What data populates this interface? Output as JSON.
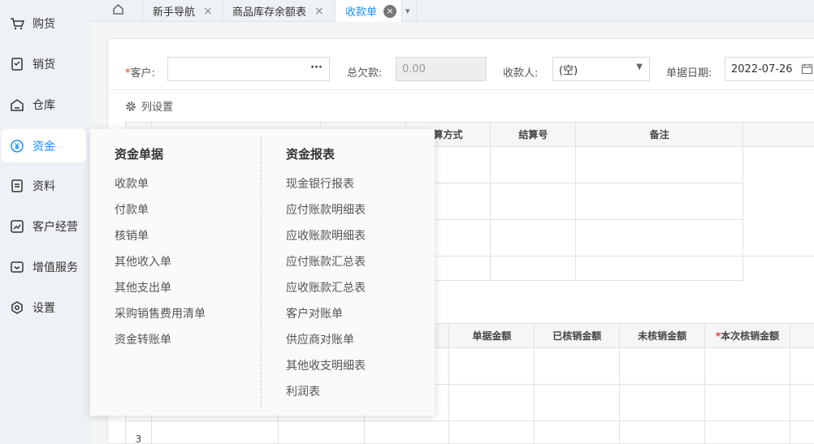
{
  "sidebar": {
    "items": [
      {
        "label": "购货",
        "icon": "cart-icon"
      },
      {
        "label": "销货",
        "icon": "sales-icon"
      },
      {
        "label": "仓库",
        "icon": "warehouse-icon"
      },
      {
        "label": "资金",
        "icon": "yuan-icon",
        "active": true
      },
      {
        "label": "资料",
        "icon": "document-icon"
      },
      {
        "label": "客户经营",
        "icon": "chart-icon"
      },
      {
        "label": "增值服务",
        "icon": "service-icon"
      },
      {
        "label": "设置",
        "icon": "settings-icon"
      }
    ],
    "accent_color": "#1890ff"
  },
  "tabs": {
    "home_icon": "home-icon",
    "items": [
      {
        "label": "新手导航"
      },
      {
        "label": "商品库存余额表"
      },
      {
        "label": "收款单",
        "active": true
      }
    ],
    "close_glyph": "×",
    "more_glyph": "▾"
  },
  "form": {
    "customer_label": "客户:",
    "customer_value": "",
    "customer_more": "···",
    "total_debt_label": "总欠款:",
    "total_debt_value": "0.00",
    "payee_label": "收款人:",
    "payee_value": "(空)",
    "date_label": "单据日期:",
    "date_value": "2022-07-26",
    "required_mark": "*"
  },
  "column_settings": "列设置",
  "table1": {
    "headers": [
      "算方式",
      "结算号",
      "备注"
    ]
  },
  "table2": {
    "headers": [
      "单据金额",
      "已核销金额",
      "未核销金额",
      "本次核销金额"
    ],
    "row_number": "3"
  },
  "dropdown": {
    "col1": {
      "title": "资金单据",
      "items": [
        "收款单",
        "付款单",
        "核销单",
        "其他收入单",
        "其他支出单",
        "采购销售费用清单",
        "资金转账单"
      ]
    },
    "col2": {
      "title": "资金报表",
      "items": [
        "现金银行报表",
        "应付账款明细表",
        "应收账款明细表",
        "应付账款汇总表",
        "应收账款汇总表",
        "客户对账单",
        "供应商对账单",
        "其他收支明细表",
        "利润表"
      ]
    }
  }
}
